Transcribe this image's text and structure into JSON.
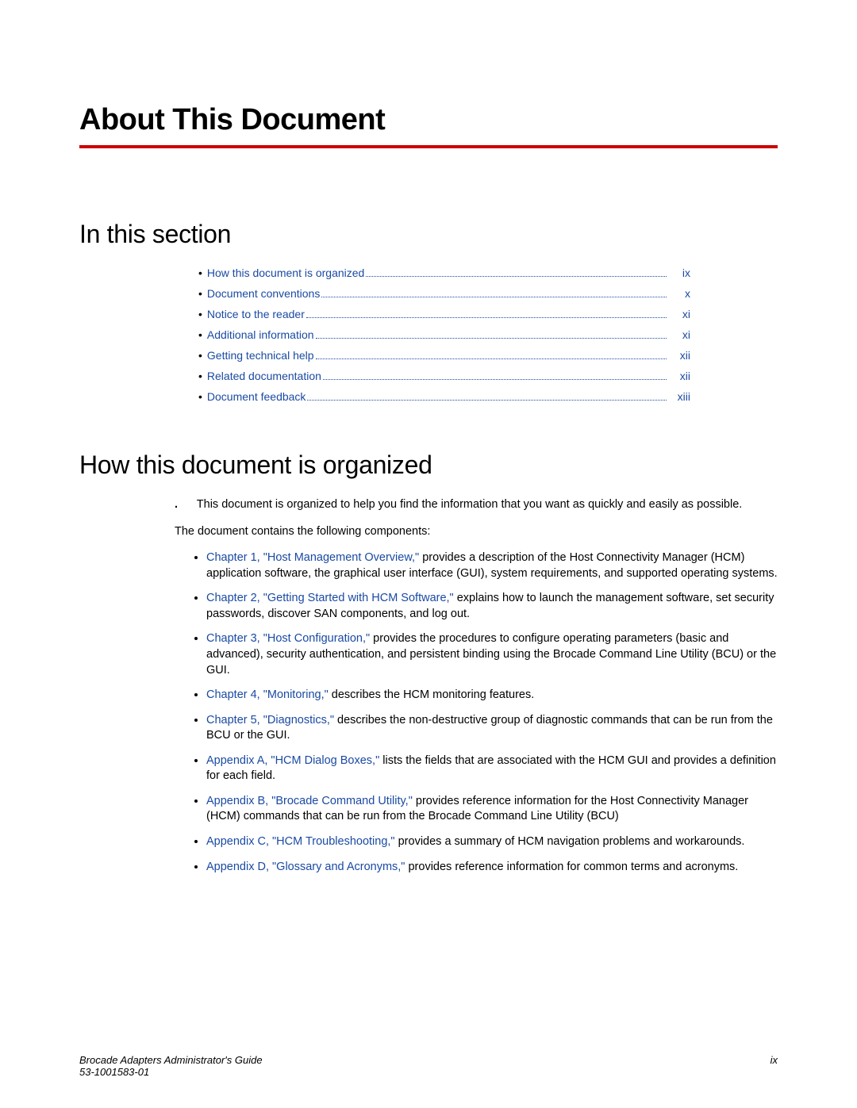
{
  "title": "About This Document",
  "section_in_this": "In this section",
  "toc": [
    {
      "label": "How this document is organized",
      "page": "ix"
    },
    {
      "label": "Document conventions",
      "page": "x"
    },
    {
      "label": "Notice to the reader",
      "page": "xi"
    },
    {
      "label": "Additional information",
      "page": "xi"
    },
    {
      "label": "Getting technical help",
      "page": "xii"
    },
    {
      "label": "Related documentation",
      "page": "xii"
    },
    {
      "label": "Document feedback",
      "page": "xiii"
    }
  ],
  "section_how": "How this document is organized",
  "intro_para": "This document is organized to help you find the information that you want as quickly and easily as possible.",
  "components_para": "The document contains the following components:",
  "chapters": [
    {
      "link": "Chapter 1, \"Host Management Overview,\"",
      "rest": " provides a description of the Host Connectivity Manager (HCM) application software, the graphical user interface (GUI), system requirements, and supported operating systems."
    },
    {
      "link": "Chapter 2, \"Getting Started with HCM Software,\"",
      "rest": " explains how to launch the management software, set security passwords, discover SAN components, and log out."
    },
    {
      "link": "Chapter 3, \"Host Configuration,\"",
      "rest": " provides the procedures to configure operating parameters (basic and advanced), security authentication, and persistent binding using the Brocade Command Line Utility (BCU) or the GUI."
    },
    {
      "link": "Chapter 4, \"Monitoring,\"",
      "rest": " describes the HCM monitoring features."
    },
    {
      "link": "Chapter 5, \"Diagnostics,\"",
      "rest": " describes the non-destructive group of diagnostic commands that can be run from the BCU or the GUI."
    },
    {
      "link": "Appendix A, \"HCM Dialog Boxes,\"",
      "rest": " lists the fields that are associated with the HCM GUI and provides a definition for each field."
    },
    {
      "link": "Appendix B, \"Brocade Command Utility,\"",
      "rest": " provides reference information for the Host Connectivity Manager (HCM) commands that can be run from the Brocade Command Line Utility (BCU)"
    },
    {
      "link": "Appendix C, \"HCM Troubleshooting,\"",
      "rest": " provides a summary of HCM navigation problems and workarounds."
    },
    {
      "link": "Appendix D, \"Glossary and Acronyms,\"",
      "rest": " provides reference information for common terms and acronyms."
    }
  ],
  "footer": {
    "guide": "Brocade Adapters Administrator's Guide",
    "docnum": "53-1001583-01",
    "pagenum": "ix"
  }
}
